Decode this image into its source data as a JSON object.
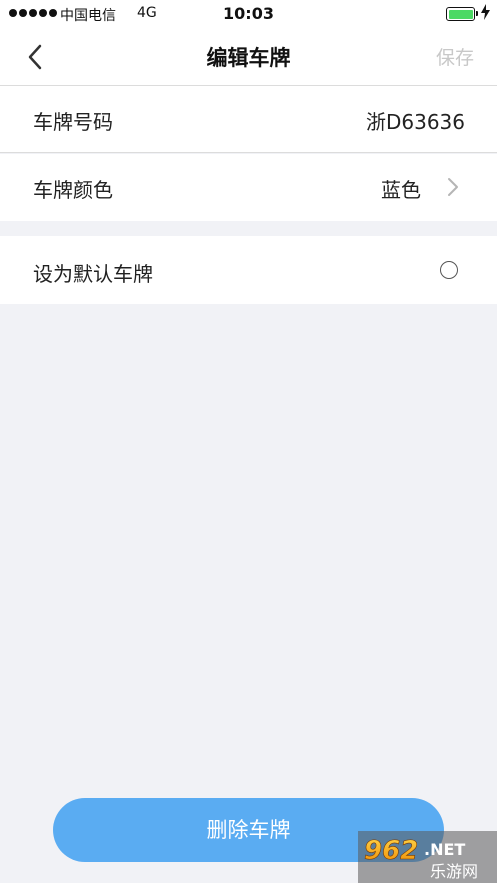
{
  "status_bar": {
    "carrier": "中国电信",
    "network": "4G",
    "time": "10:03",
    "battery_level": 1.0,
    "battery_color": "#4cd964"
  },
  "nav": {
    "back_icon": "chevron-left-icon",
    "title": "编辑车牌",
    "save_label": "保存"
  },
  "form": {
    "plate_number_label": "车牌号码",
    "plate_number_value": "浙D63636",
    "plate_color_label": "车牌颜色",
    "plate_color_value": "蓝色",
    "default_label": "设为默认车牌",
    "default_checked": false
  },
  "delete_button_label": "删除车牌",
  "watermark": {
    "logo_text": "962.NET",
    "sub_text": "乐游网"
  },
  "colors": {
    "accent": "#5aacf2",
    "background": "#f1f2f6"
  }
}
